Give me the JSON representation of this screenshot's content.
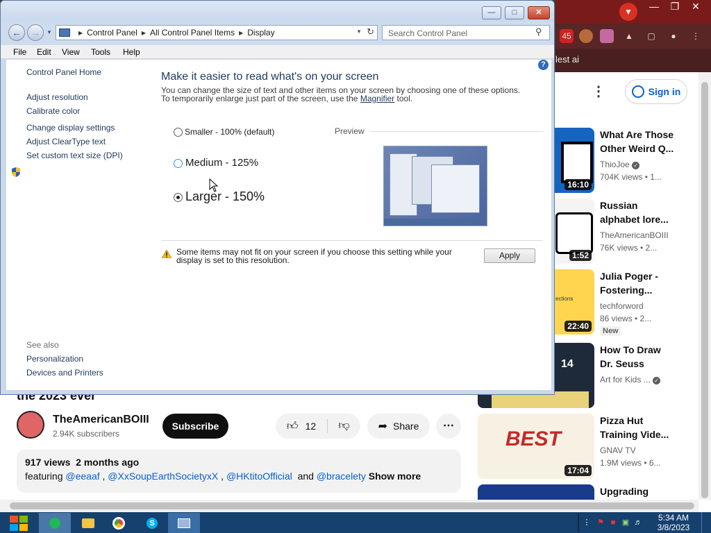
{
  "browser": {
    "bookmark_text": "lest ai",
    "tab_badge": "45",
    "sign_in": "Sign in",
    "recommendations": [
      {
        "title": "What Are Those Other Weird Q...",
        "channel": "ThioJoe",
        "meta": "704K views  • 1...",
        "duration": "16:10",
        "verified": true,
        "thumb_text": "???"
      },
      {
        "title": "Russian alphabet lore...",
        "channel": "TheAmericanBOIII",
        "meta": "76K views  • 2...",
        "duration": "1:52",
        "verified": false,
        "thumb_text": ""
      },
      {
        "title": "Julia Poger - Fostering...",
        "channel": "techforword",
        "meta": "86 views  • 2...",
        "duration": "22:40",
        "badge": "New",
        "verified": false,
        "thumb_text": "ections"
      },
      {
        "title": "How To Draw Dr. Seuss",
        "channel": "Art for Kids ...",
        "meta": "",
        "duration": "",
        "verified": true,
        "thumb_text": "14"
      },
      {
        "title": "Pizza Hut Training Vide...",
        "channel": "GNAV TV",
        "meta": "1.9M views  • 6...",
        "duration": "17:04",
        "verified": false,
        "thumb_text": "BEST"
      },
      {
        "title": "Upgrading",
        "channel": "",
        "meta": "",
        "duration": "",
        "verified": false,
        "thumb_text": ""
      }
    ],
    "video": {
      "title_fragment": "the 2023 ever",
      "channel_name": "TheAmericanBOIII",
      "subscribers": "2.94K subscribers",
      "subscribe_label": "Subscribe",
      "likes": "12",
      "share_label": "Share",
      "views": "917 views",
      "age": "2 months ago",
      "desc_prefix": "featuring",
      "mentions": [
        "@eeaaf",
        "@XxSoupEarthSocietyxX",
        "@HKtitoOfficial",
        "@bracelety"
      ],
      "desc_and": "and",
      "show_more": "Show more"
    }
  },
  "control_panel": {
    "breadcrumbs": [
      "Control Panel",
      "All Control Panel Items",
      "Display"
    ],
    "search_placeholder": "Search Control Panel",
    "menu": [
      "File",
      "Edit",
      "View",
      "Tools",
      "Help"
    ],
    "sidebar": {
      "home": "Control Panel Home",
      "links": [
        "Adjust resolution",
        "Calibrate color",
        "Change display settings",
        "Adjust ClearType text",
        "Set custom text size (DPI)"
      ],
      "see_also_heading": "See also",
      "see_also": [
        "Personalization",
        "Devices and Printers"
      ]
    },
    "main": {
      "title": "Make it easier to read what's on your screen",
      "desc_line1": "You can change the size of text and other items on your screen by choosing one of these options.",
      "desc_line2_prefix": "To temporarily enlarge just part of the screen, use the",
      "magnifier_link": "Magnifier",
      "desc_line2_suffix": "tool.",
      "options": [
        {
          "label": "Smaller - 100% (default)",
          "selected": false
        },
        {
          "label": "Medium - 125%",
          "selected": false
        },
        {
          "label": "Larger - 150%",
          "selected": true
        }
      ],
      "preview_label": "Preview",
      "warning": "Some items may not fit on your screen if you choose this setting while your display is set to this resolution.",
      "apply_label": "Apply"
    }
  },
  "taskbar": {
    "time": "5:34 AM",
    "date": "3/8/2023"
  },
  "colors": {
    "taskbar": "#16406e",
    "cp_link": "#1e395b",
    "yt_link": "#065fd4"
  }
}
